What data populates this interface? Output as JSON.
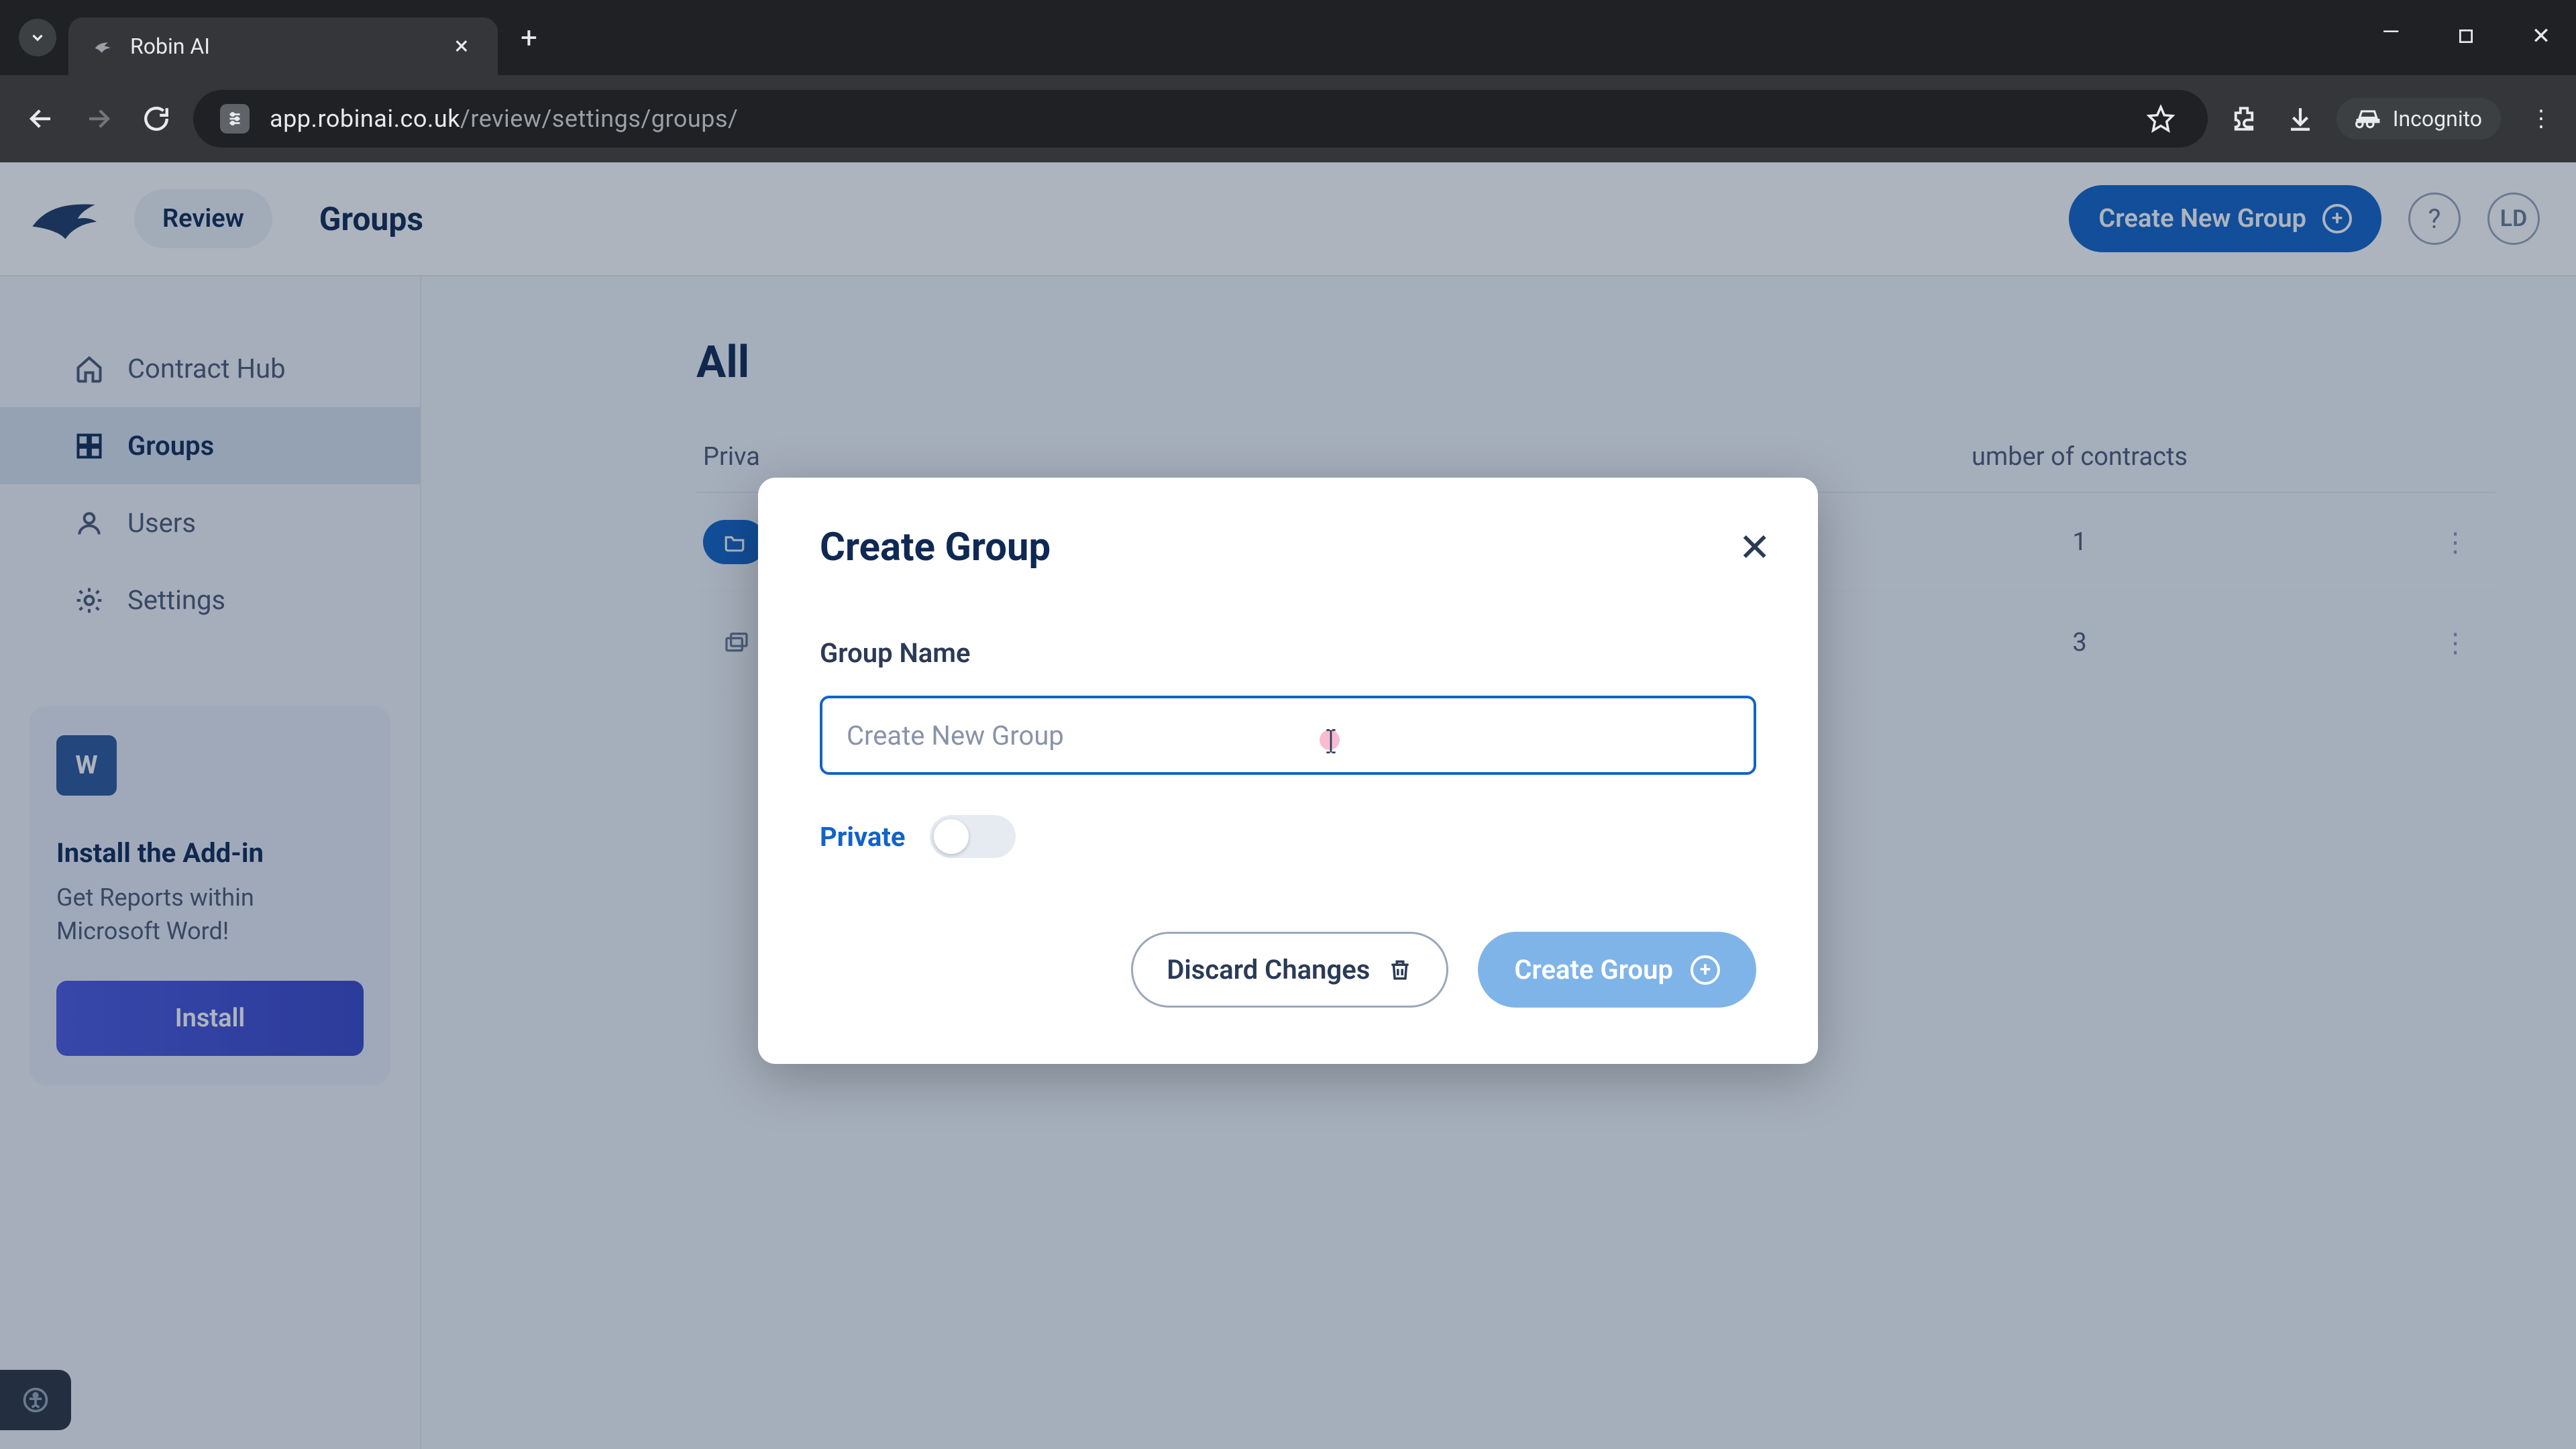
{
  "browser": {
    "tab_title": "Robin AI",
    "url_host": "app.robinai.co.uk",
    "url_path": "/review/settings/groups/",
    "incognito_label": "Incognito"
  },
  "header": {
    "review_label": "Review",
    "page_title": "Groups",
    "create_button": "Create New Group",
    "help_symbol": "?",
    "avatar_initials": "LD"
  },
  "sidebar": {
    "items": [
      {
        "label": "Contract Hub"
      },
      {
        "label": "Groups"
      },
      {
        "label": "Users"
      },
      {
        "label": "Settings"
      }
    ],
    "addin": {
      "title": "Install the Add-in",
      "subtitle": "Get Reports within Microsoft Word!",
      "button": "Install",
      "icon_text": "W"
    }
  },
  "main": {
    "heading_partial": "All",
    "columns": {
      "private": "Priva",
      "contracts_partial": "umber of contracts"
    },
    "rows": [
      {
        "count": "1"
      },
      {
        "count": "3"
      }
    ]
  },
  "modal": {
    "title": "Create Group",
    "field_label": "Group Name",
    "placeholder": "Create New Group",
    "private_label": "Private",
    "discard_label": "Discard Changes",
    "create_label": "Create Group"
  }
}
